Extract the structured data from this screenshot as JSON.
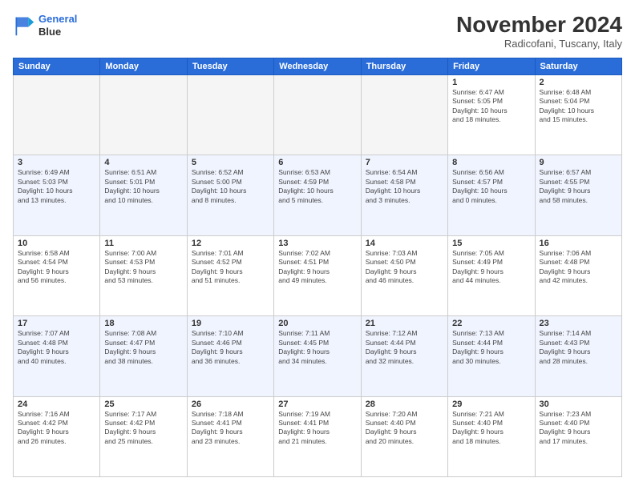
{
  "logo": {
    "line1": "General",
    "line2": "Blue"
  },
  "title": "November 2024",
  "subtitle": "Radicofani, Tuscany, Italy",
  "weekdays": [
    "Sunday",
    "Monday",
    "Tuesday",
    "Wednesday",
    "Thursday",
    "Friday",
    "Saturday"
  ],
  "weeks": [
    [
      {
        "day": "",
        "info": ""
      },
      {
        "day": "",
        "info": ""
      },
      {
        "day": "",
        "info": ""
      },
      {
        "day": "",
        "info": ""
      },
      {
        "day": "",
        "info": ""
      },
      {
        "day": "1",
        "info": "Sunrise: 6:47 AM\nSunset: 5:05 PM\nDaylight: 10 hours\nand 18 minutes."
      },
      {
        "day": "2",
        "info": "Sunrise: 6:48 AM\nSunset: 5:04 PM\nDaylight: 10 hours\nand 15 minutes."
      }
    ],
    [
      {
        "day": "3",
        "info": "Sunrise: 6:49 AM\nSunset: 5:03 PM\nDaylight: 10 hours\nand 13 minutes."
      },
      {
        "day": "4",
        "info": "Sunrise: 6:51 AM\nSunset: 5:01 PM\nDaylight: 10 hours\nand 10 minutes."
      },
      {
        "day": "5",
        "info": "Sunrise: 6:52 AM\nSunset: 5:00 PM\nDaylight: 10 hours\nand 8 minutes."
      },
      {
        "day": "6",
        "info": "Sunrise: 6:53 AM\nSunset: 4:59 PM\nDaylight: 10 hours\nand 5 minutes."
      },
      {
        "day": "7",
        "info": "Sunrise: 6:54 AM\nSunset: 4:58 PM\nDaylight: 10 hours\nand 3 minutes."
      },
      {
        "day": "8",
        "info": "Sunrise: 6:56 AM\nSunset: 4:57 PM\nDaylight: 10 hours\nand 0 minutes."
      },
      {
        "day": "9",
        "info": "Sunrise: 6:57 AM\nSunset: 4:55 PM\nDaylight: 9 hours\nand 58 minutes."
      }
    ],
    [
      {
        "day": "10",
        "info": "Sunrise: 6:58 AM\nSunset: 4:54 PM\nDaylight: 9 hours\nand 56 minutes."
      },
      {
        "day": "11",
        "info": "Sunrise: 7:00 AM\nSunset: 4:53 PM\nDaylight: 9 hours\nand 53 minutes."
      },
      {
        "day": "12",
        "info": "Sunrise: 7:01 AM\nSunset: 4:52 PM\nDaylight: 9 hours\nand 51 minutes."
      },
      {
        "day": "13",
        "info": "Sunrise: 7:02 AM\nSunset: 4:51 PM\nDaylight: 9 hours\nand 49 minutes."
      },
      {
        "day": "14",
        "info": "Sunrise: 7:03 AM\nSunset: 4:50 PM\nDaylight: 9 hours\nand 46 minutes."
      },
      {
        "day": "15",
        "info": "Sunrise: 7:05 AM\nSunset: 4:49 PM\nDaylight: 9 hours\nand 44 minutes."
      },
      {
        "day": "16",
        "info": "Sunrise: 7:06 AM\nSunset: 4:48 PM\nDaylight: 9 hours\nand 42 minutes."
      }
    ],
    [
      {
        "day": "17",
        "info": "Sunrise: 7:07 AM\nSunset: 4:48 PM\nDaylight: 9 hours\nand 40 minutes."
      },
      {
        "day": "18",
        "info": "Sunrise: 7:08 AM\nSunset: 4:47 PM\nDaylight: 9 hours\nand 38 minutes."
      },
      {
        "day": "19",
        "info": "Sunrise: 7:10 AM\nSunset: 4:46 PM\nDaylight: 9 hours\nand 36 minutes."
      },
      {
        "day": "20",
        "info": "Sunrise: 7:11 AM\nSunset: 4:45 PM\nDaylight: 9 hours\nand 34 minutes."
      },
      {
        "day": "21",
        "info": "Sunrise: 7:12 AM\nSunset: 4:44 PM\nDaylight: 9 hours\nand 32 minutes."
      },
      {
        "day": "22",
        "info": "Sunrise: 7:13 AM\nSunset: 4:44 PM\nDaylight: 9 hours\nand 30 minutes."
      },
      {
        "day": "23",
        "info": "Sunrise: 7:14 AM\nSunset: 4:43 PM\nDaylight: 9 hours\nand 28 minutes."
      }
    ],
    [
      {
        "day": "24",
        "info": "Sunrise: 7:16 AM\nSunset: 4:42 PM\nDaylight: 9 hours\nand 26 minutes."
      },
      {
        "day": "25",
        "info": "Sunrise: 7:17 AM\nSunset: 4:42 PM\nDaylight: 9 hours\nand 25 minutes."
      },
      {
        "day": "26",
        "info": "Sunrise: 7:18 AM\nSunset: 4:41 PM\nDaylight: 9 hours\nand 23 minutes."
      },
      {
        "day": "27",
        "info": "Sunrise: 7:19 AM\nSunset: 4:41 PM\nDaylight: 9 hours\nand 21 minutes."
      },
      {
        "day": "28",
        "info": "Sunrise: 7:20 AM\nSunset: 4:40 PM\nDaylight: 9 hours\nand 20 minutes."
      },
      {
        "day": "29",
        "info": "Sunrise: 7:21 AM\nSunset: 4:40 PM\nDaylight: 9 hours\nand 18 minutes."
      },
      {
        "day": "30",
        "info": "Sunrise: 7:23 AM\nSunset: 4:40 PM\nDaylight: 9 hours\nand 17 minutes."
      }
    ]
  ]
}
